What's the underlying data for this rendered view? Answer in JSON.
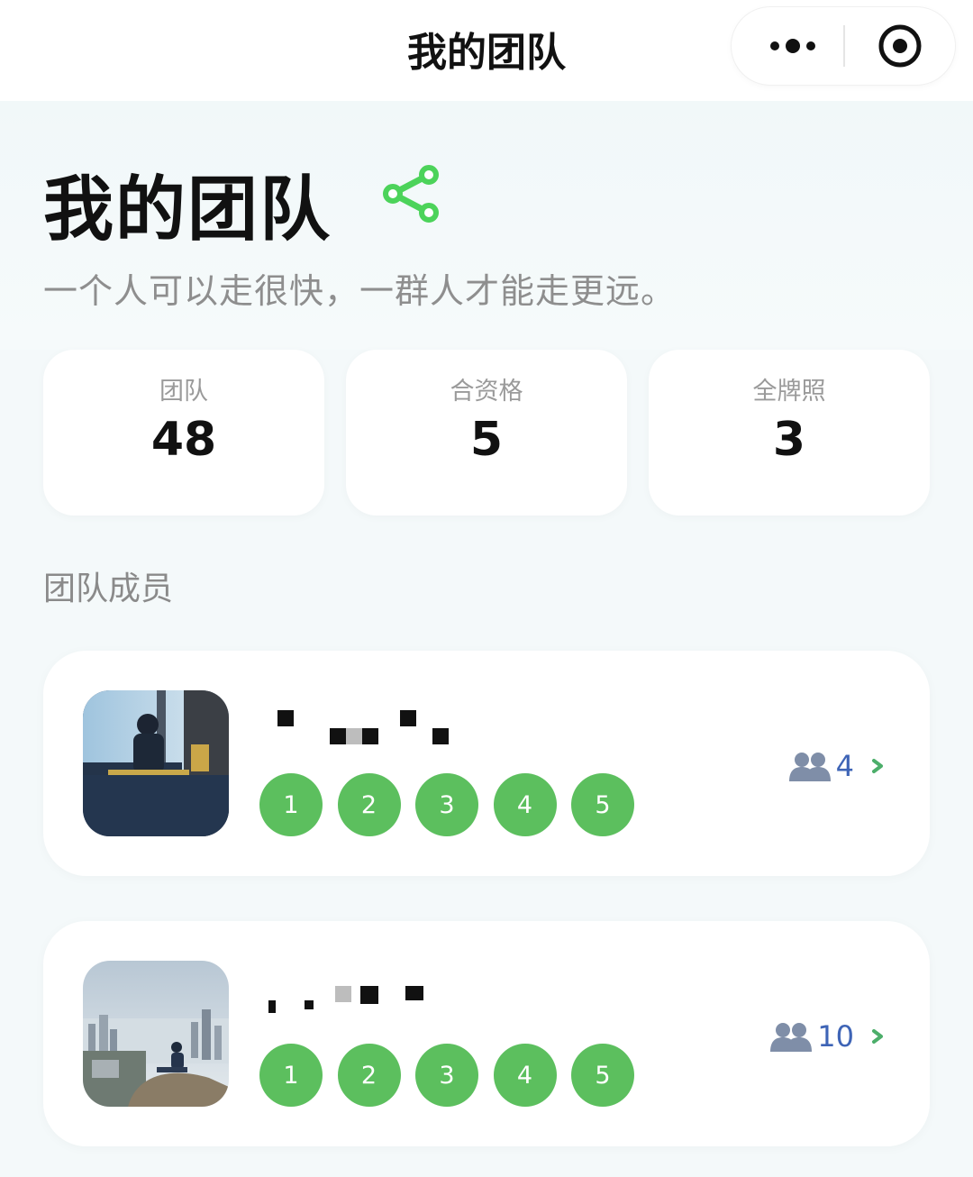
{
  "navbar": {
    "title": "我的团队",
    "more_icon": "more-dots-icon",
    "close_icon": "target-close-icon"
  },
  "header": {
    "title": "我的团队",
    "share_icon": "share-icon",
    "subtitle": "一个人可以走很快，一群人才能走更远。",
    "accent_color": "#4cd35a"
  },
  "stats": [
    {
      "label": "团队",
      "value": "48"
    },
    {
      "label": "合资格",
      "value": "5"
    },
    {
      "label": "全牌照",
      "value": "3"
    }
  ],
  "members_section": {
    "title": "团队成员",
    "members": [
      {
        "levels": [
          "1",
          "2",
          "3",
          "4",
          "5"
        ],
        "team_count": "4",
        "count_icon": "people-icon",
        "chevron_icon": "chevron-right-icon"
      },
      {
        "levels": [
          "1",
          "2",
          "3",
          "4",
          "5"
        ],
        "team_count": "10",
        "count_icon": "people-icon",
        "chevron_icon": "chevron-right-icon"
      }
    ]
  },
  "colors": {
    "level_badge": "#5cbf5e",
    "team_count": "#3e64b6",
    "chevron": "#4cae6a",
    "background": "#f4f9fa"
  }
}
